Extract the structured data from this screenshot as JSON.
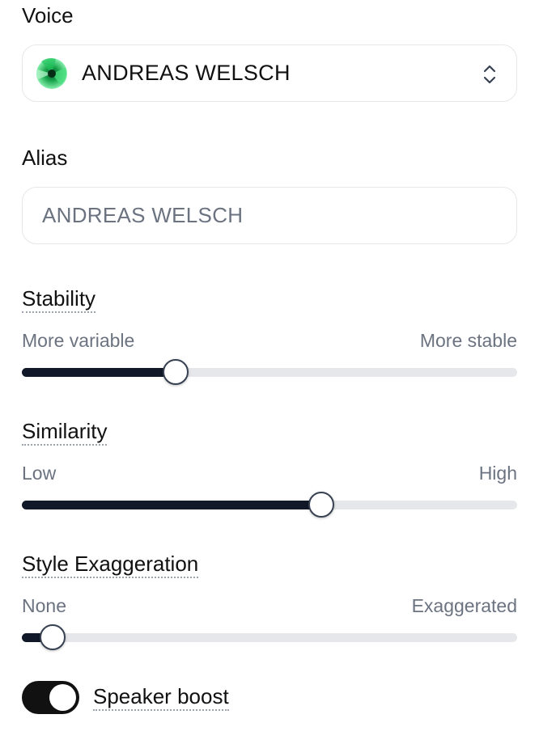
{
  "voice": {
    "label": "Voice",
    "selected_name": "ANDREAS WELSCH",
    "avatar_icon": "voice-avatar-icon",
    "selector_icon": "chevron-up-down-icon"
  },
  "alias": {
    "label": "Alias",
    "placeholder": "ANDREAS WELSCH",
    "value": ""
  },
  "sliders": [
    {
      "label": "Stability",
      "min_label": "More variable",
      "max_label": "More stable",
      "value": 0.31
    },
    {
      "label": "Similarity",
      "min_label": "Low",
      "max_label": "High",
      "value": 0.605
    },
    {
      "label": "Style Exaggeration",
      "min_label": "None",
      "max_label": "Exaggerated",
      "value": 0.062
    }
  ],
  "speaker_boost": {
    "label": "Speaker boost",
    "enabled": true
  },
  "colors": {
    "accent": "#111827",
    "track": "#e5e7eb",
    "muted_text": "#6b7280",
    "avatar_green": "#22c55e"
  }
}
